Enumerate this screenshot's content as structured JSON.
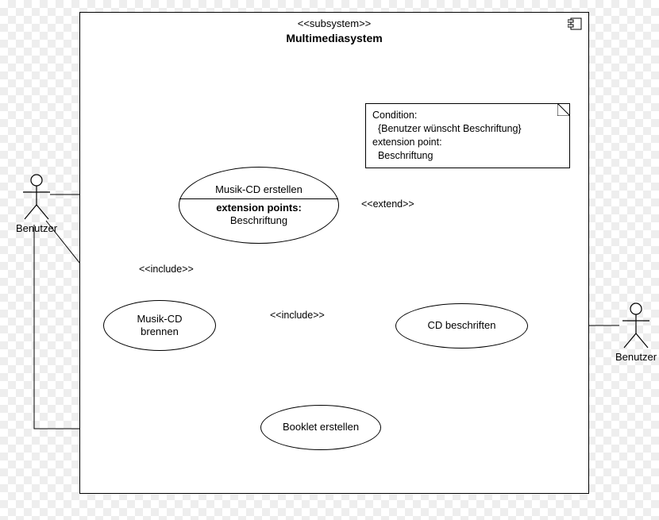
{
  "system": {
    "stereotype": "<<subsystem>>",
    "title": "Multimediasystem"
  },
  "actors": {
    "left": {
      "name": "Benutzer"
    },
    "right": {
      "name": "Benutzer"
    }
  },
  "usecases": {
    "create_cd": {
      "title": "Musik-CD erstellen",
      "ext_label": "extension points:",
      "ext_point": "Beschriftung"
    },
    "burn_cd": {
      "title": "Musik-CD\nbrennen"
    },
    "booklet": {
      "title": "Booklet erstellen"
    },
    "label_cd": {
      "title": "CD beschriften"
    }
  },
  "note": {
    "line1": "Condition:",
    "line2": "  {Benutzer wünscht Beschriftung}",
    "line3": "extension point:",
    "line4": "  Beschriftung"
  },
  "labels": {
    "extend": "<<extend>>",
    "include": "<<include>>"
  }
}
